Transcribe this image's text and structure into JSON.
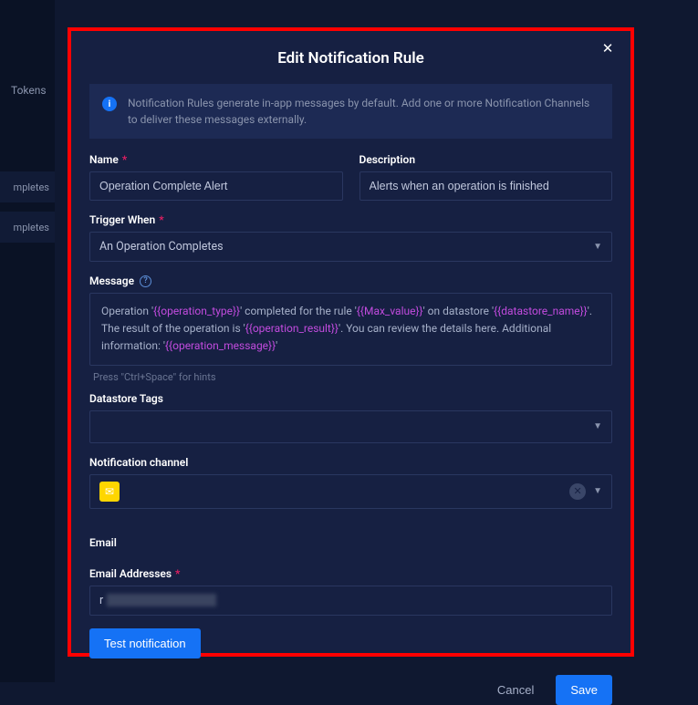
{
  "background": {
    "tokens_label": "Tokens",
    "row1": "mpletes",
    "row2": "mpletes"
  },
  "modal": {
    "title": "Edit Notification Rule",
    "info_text": "Notification Rules generate in-app messages by default. Add one or more Notification Channels to deliver these messages externally.",
    "labels": {
      "name": "Name",
      "description": "Description",
      "trigger_when": "Trigger When",
      "message": "Message",
      "hint": "Press \"Ctrl+Space\" for hints",
      "datastore_tags": "Datastore Tags",
      "notification_channel": "Notification channel",
      "email": "Email",
      "email_addresses": "Email Addresses"
    },
    "fields": {
      "name": "Operation Complete Alert",
      "description": "Alerts when an operation is finished",
      "trigger_when": "An Operation Completes",
      "email_address": "r"
    },
    "message": {
      "part1": "Operation '",
      "tok1": "{{operation_type}}",
      "part2": "' completed for the rule '",
      "tok2": "{{Max_value}}",
      "part3": "' on datastore '",
      "tok3": "{{datastore_name}}",
      "part4": "'. The result of the operation is '",
      "tok4": "{{operation_result}}",
      "part5": "'. You can review the details here. Additional information: '",
      "tok5": "{{operation_message}}",
      "part6": "'"
    },
    "buttons": {
      "test": "Test notification",
      "cancel": "Cancel",
      "save": "Save"
    }
  }
}
